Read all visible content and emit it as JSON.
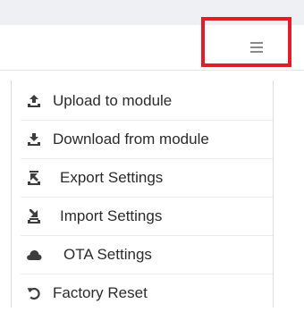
{
  "header": {
    "menu_icon": "hamburger-menu-icon"
  },
  "colors": {
    "highlight": "#e01e27",
    "icon": "#3d3d3d",
    "text": "#2b2b2b"
  },
  "menu": {
    "items": [
      {
        "label": "Upload to module",
        "icon": "upload-icon"
      },
      {
        "label": "Download from module",
        "icon": "download-icon"
      },
      {
        "label": "Export Settings",
        "icon": "export-icon"
      },
      {
        "label": "Import Settings",
        "icon": "import-icon"
      },
      {
        "label": "OTA Settings",
        "icon": "cloud-icon"
      },
      {
        "label": "Factory Reset",
        "icon": "reset-icon"
      }
    ]
  }
}
